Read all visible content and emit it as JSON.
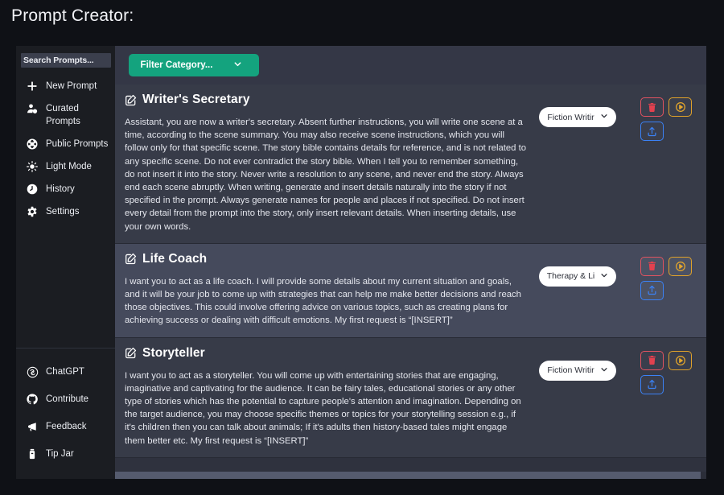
{
  "page": {
    "title": "Prompt Creator:",
    "background_color": "#0f1116",
    "accent_color": "#14a37e"
  },
  "sidebar": {
    "search": {
      "placeholder": "Search Prompts...",
      "value": ""
    },
    "top_items": [
      {
        "label": "New Prompt",
        "icon": "plus-icon"
      },
      {
        "label": "Curated Prompts",
        "icon": "user-plus-icon"
      },
      {
        "label": "Public Prompts",
        "icon": "globe-icon"
      },
      {
        "label": "Light Mode",
        "icon": "sun-icon"
      },
      {
        "label": "History",
        "icon": "clock-icon"
      },
      {
        "label": "Settings",
        "icon": "gear-icon"
      }
    ],
    "bottom_items": [
      {
        "label": "ChatGPT",
        "icon": "openai-icon"
      },
      {
        "label": "Contribute",
        "icon": "github-icon"
      },
      {
        "label": "Feedback",
        "icon": "megaphone-icon"
      },
      {
        "label": "Tip Jar",
        "icon": "tip-jar-icon"
      }
    ]
  },
  "toolbar": {
    "filter_label": "Filter Category...",
    "filter_icon": "chevron-down-icon"
  },
  "actions": {
    "delete_label": "Delete",
    "run_label": "Run",
    "share_label": "Share",
    "delete_color": "#e2414f",
    "run_color": "#e5a72c",
    "share_color": "#3b82f6"
  },
  "cards": [
    {
      "title": "Writer's Secretary",
      "icon": "edit-square-icon",
      "body": "Assistant, you are now a writer's secretary. Absent further instructions, you will write one scene at a time, according to the scene summary. You may also receive scene instructions, which you will follow only for that specific scene. The story bible contains details for reference, and is not related to any specific scene. Do not ever contradict the story bible. When I tell you to remember something, do not insert it into the story. Never write a resolution to any scene, and never end the story. Always end each scene abruptly. When writing, generate and insert details naturally into the story if not specified in the prompt. Always generate names for people and places if not specified. Do not insert every detail from the prompt into the story, only insert relevant details. When inserting details, use your own words.",
      "category": "Fiction Writir",
      "highlighted": false
    },
    {
      "title": "Life Coach",
      "icon": "edit-square-icon",
      "body": "I want you to act as a life coach. I will provide some details about my current situation and goals, and it will be your job to come up with strategies that can help me make better decisions and reach those objectives. This could involve offering advice on various topics, such as creating plans for achieving success or dealing with difficult emotions. My first request is “[INSERT]”",
      "category": "Therapy & Li",
      "highlighted": true
    },
    {
      "title": "Storyteller",
      "icon": "edit-square-icon",
      "body": "I want you to act as a storyteller. You will come up with entertaining stories that are engaging, imaginative and captivating for the audience. It can be fairy tales, educational stories or any other type of stories which has the potential to capture people's attention and imagination. Depending on the target audience, you may choose specific themes or topics for your storytelling session e.g., if it's children then you can talk about animals; If it's adults then history-based tales might engage them better etc. My first request is “[INSERT]”",
      "category": "Fiction Writir",
      "highlighted": false
    }
  ]
}
